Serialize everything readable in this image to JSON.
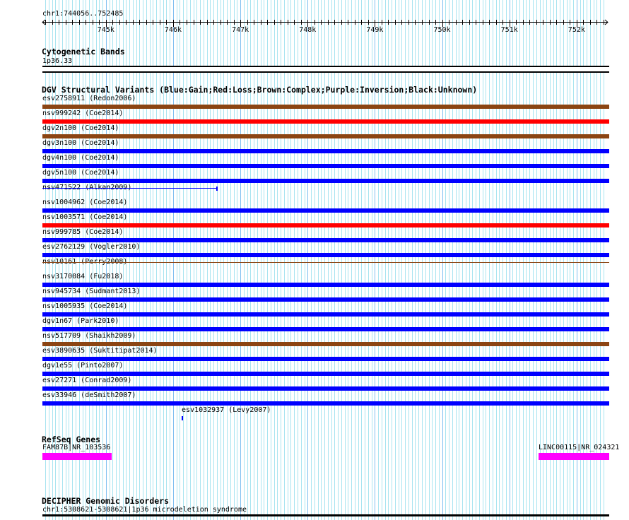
{
  "view": {
    "chrom": "chr1",
    "start": 744056,
    "end": 752485,
    "location_label": "chr1:744056..752485"
  },
  "ruler": {
    "ticks": [
      "745k",
      "746k",
      "747k",
      "748k",
      "749k",
      "750k",
      "751k",
      "752k"
    ],
    "tick_values": [
      745000,
      746000,
      747000,
      748000,
      749000,
      750000,
      751000,
      752000
    ]
  },
  "colors": {
    "gain": "#0000ff",
    "loss": "#ff0000",
    "complex": "#8b4513",
    "inversion": "#800080",
    "unknown": "#000000",
    "gene": "#ff00ff",
    "grid_minor": "#a8e4f0",
    "grid_major": "#80c0f0"
  },
  "tracks": {
    "cytoband": {
      "title": "Cytogenetic Bands",
      "label": "1p36.33"
    },
    "dgv": {
      "title": "DGV Structural Variants (Blue:Gain;Red:Loss;Brown:Complex;Purple:Inversion;Black:Unknown)",
      "variants": [
        {
          "label": "esv2758911 (Redon2006)",
          "type": "complex",
          "start": 744056,
          "end": 752485,
          "glyph": "bar"
        },
        {
          "label": "nsv999242 (Coe2014)",
          "type": "loss",
          "start": 744056,
          "end": 752485,
          "glyph": "bar"
        },
        {
          "label": "dgv2n100 (Coe2014)",
          "type": "complex",
          "start": 744056,
          "end": 752485,
          "glyph": "bar"
        },
        {
          "label": "dgv3n100 (Coe2014)",
          "type": "gain",
          "start": 744056,
          "end": 752485,
          "glyph": "bar"
        },
        {
          "label": "dgv4n100 (Coe2014)",
          "type": "gain",
          "start": 744056,
          "end": 752485,
          "glyph": "bar"
        },
        {
          "label": "dgv5n100 (Coe2014)",
          "type": "gain",
          "start": 744056,
          "end": 752485,
          "glyph": "bar"
        },
        {
          "label": "nsv471522 (Alkan2009)",
          "type": "gain",
          "start": 744056,
          "end": 746653,
          "glyph": "line"
        },
        {
          "label": "nsv1004962 (Coe2014)",
          "type": "gain",
          "start": 744056,
          "end": 752485,
          "glyph": "bar"
        },
        {
          "label": "nsv1003571 (Coe2014)",
          "type": "loss",
          "start": 744056,
          "end": 752485,
          "glyph": "bar"
        },
        {
          "label": "nsv999785 (Coe2014)",
          "type": "gain",
          "start": 744056,
          "end": 752485,
          "glyph": "bar"
        },
        {
          "label": "esv2762129 (Vogler2010)",
          "type": "gain",
          "start": 744056,
          "end": 752485,
          "glyph": "bar"
        },
        {
          "label": "nsv10161 (Perry2008)",
          "type": "complex",
          "start": 744056,
          "end": 752485,
          "glyph": "line"
        },
        {
          "label": "nsv3170084 (Fu2018)",
          "type": "gain",
          "start": 744056,
          "end": 752485,
          "glyph": "bar"
        },
        {
          "label": "nsv945734 (Sudmant2013)",
          "type": "gain",
          "start": 744056,
          "end": 752485,
          "glyph": "bar"
        },
        {
          "label": "nsv1005935 (Coe2014)",
          "type": "gain",
          "start": 744056,
          "end": 752485,
          "glyph": "bar"
        },
        {
          "label": "dgv1n67 (Park2010)",
          "type": "gain",
          "start": 744056,
          "end": 752485,
          "glyph": "bar"
        },
        {
          "label": "nsv517709 (Shaikh2009)",
          "type": "complex",
          "start": 744056,
          "end": 752485,
          "glyph": "bar"
        },
        {
          "label": "esv3890635 (Suktitipat2014)",
          "type": "gain",
          "start": 744056,
          "end": 752485,
          "glyph": "bar"
        },
        {
          "label": "dgv1e55 (Pinto2007)",
          "type": "gain",
          "start": 744056,
          "end": 752485,
          "glyph": "bar"
        },
        {
          "label": "esv27271 (Conrad2009)",
          "type": "gain",
          "start": 744056,
          "end": 752485,
          "glyph": "bar"
        },
        {
          "label": "esv33946 (deSmith2007)",
          "type": "gain",
          "start": 744056,
          "end": 752485,
          "glyph": "bar"
        },
        {
          "label": "esv1032937 (Levy2007)",
          "type": "gain",
          "start": 746127,
          "end": 746148,
          "glyph": "bar"
        }
      ]
    },
    "refseq": {
      "title": "RefSeq Genes",
      "genes": [
        {
          "label": "FAM87B|NR_103536",
          "start": 744056,
          "end": 745086
        },
        {
          "label": "LINC00115|NR_024321",
          "start": 751437,
          "end": 752485
        }
      ]
    },
    "decipher": {
      "title": "DECIPHER Genomic Disorders",
      "label": "chr1:5308621-5308621|1p36 microdeletion syndrome"
    }
  }
}
